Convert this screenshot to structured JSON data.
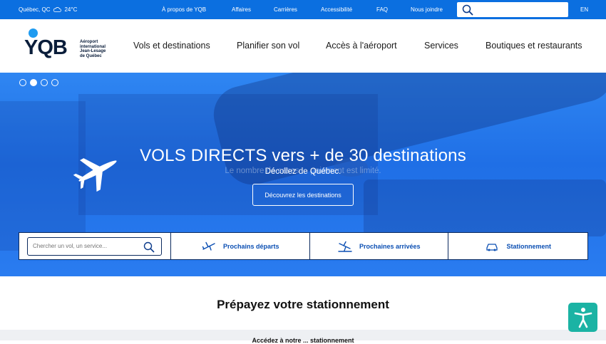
{
  "topbar": {
    "weather": {
      "location": "Québec, QC",
      "temperature": "24°C",
      "icon": "cloud-icon"
    },
    "links": [
      "À propos de YQB",
      "Affaires",
      "Carrières",
      "Accessibilité",
      "FAQ",
      "Nous joindre"
    ],
    "search": {
      "placeholder": "",
      "icon": "search-icon"
    },
    "language": "EN",
    "color": "#0b6fe0"
  },
  "header": {
    "logo": {
      "mark": "YQB",
      "subtitle_lines": [
        "Aéroport",
        "international",
        "Jean-Lesage",
        "de Québec"
      ]
    },
    "nav": [
      "Vols et destinations",
      "Planifier son vol",
      "Accès à l'aéroport",
      "Services",
      "Boutiques et restaurants"
    ]
  },
  "hero": {
    "slides_total": 4,
    "slide_active": 2,
    "title": "VOLS DIRECTS vers + de 30 destinations",
    "ghost_text": "Le nombre de cases ... paiement est limité.",
    "subtitle": "Décollez de Québec.",
    "button": "Découvrez les destinations"
  },
  "quickbar": {
    "search_placeholder": "Chercher un vol, un service...",
    "departures": {
      "label": "Prochains départs",
      "icon": "departure-plane-icon"
    },
    "arrivals": {
      "label": "Prochaines arrivées",
      "icon": "arrival-plane-icon"
    },
    "parking": {
      "label": "Stationnement",
      "icon": "car-icon"
    }
  },
  "section": {
    "title": "Prépayez votre stationnement",
    "strip_text": "Accédez à notre ... stationnement"
  },
  "accessibility_button": {
    "icon": "accessibility-icon",
    "color": "#1bb3a4"
  }
}
